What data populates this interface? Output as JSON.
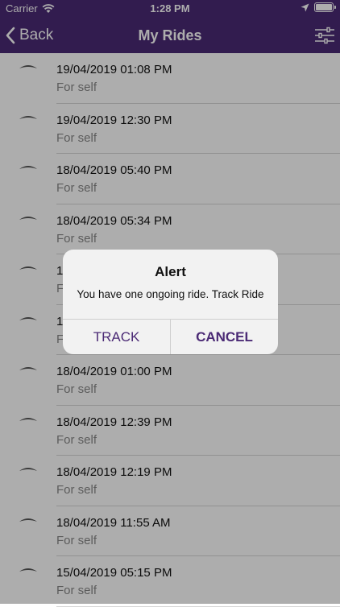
{
  "status_bar": {
    "carrier": "Carrier",
    "time": "1:28 PM"
  },
  "nav": {
    "back_label": "Back",
    "title": "My Rides"
  },
  "colors": {
    "brand": "#4b2a75"
  },
  "rides": [
    {
      "datetime": "19/04/2019 01:08 PM",
      "for": "For self"
    },
    {
      "datetime": "19/04/2019 12:30 PM",
      "for": "For self"
    },
    {
      "datetime": "18/04/2019 05:40 PM",
      "for": "For self"
    },
    {
      "datetime": "18/04/2019 05:34 PM",
      "for": "For self"
    },
    {
      "datetime": "1",
      "for": "F"
    },
    {
      "datetime": "1",
      "for": "F"
    },
    {
      "datetime": "18/04/2019 01:00 PM",
      "for": "For self"
    },
    {
      "datetime": "18/04/2019 12:39 PM",
      "for": "For self"
    },
    {
      "datetime": "18/04/2019 12:19 PM",
      "for": "For self"
    },
    {
      "datetime": "18/04/2019 11:55 AM",
      "for": "For self"
    },
    {
      "datetime": "15/04/2019 05:15 PM",
      "for": "For self"
    }
  ],
  "alert": {
    "title": "Alert",
    "message": "You have one ongoing ride. Track Ride",
    "track_label": "TRACK",
    "cancel_label": "CANCEL"
  }
}
